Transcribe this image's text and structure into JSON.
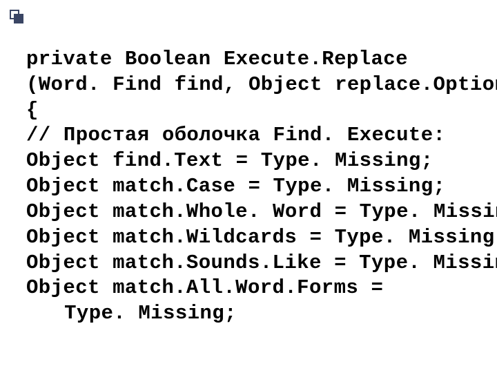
{
  "code": {
    "l1": "private Boolean Execute.Replace",
    "l2": "(Word. Find find, Object replace.Option)",
    "l3": "{",
    "l4": "// Простая оболочка Find. Execute:",
    "l5": "Object find.Text = Type. Missing;",
    "l6": "Object match.Case = Type. Missing;",
    "l7": "Object match.Whole. Word = Type. Missing;",
    "l8": "Object match.Wildcards = Type. Missing;",
    "l9": "Object match.Sounds.Like = Type. Missing;",
    "l10": "Object match.All.Word.Forms =",
    "l11": "Type. Missing;"
  }
}
